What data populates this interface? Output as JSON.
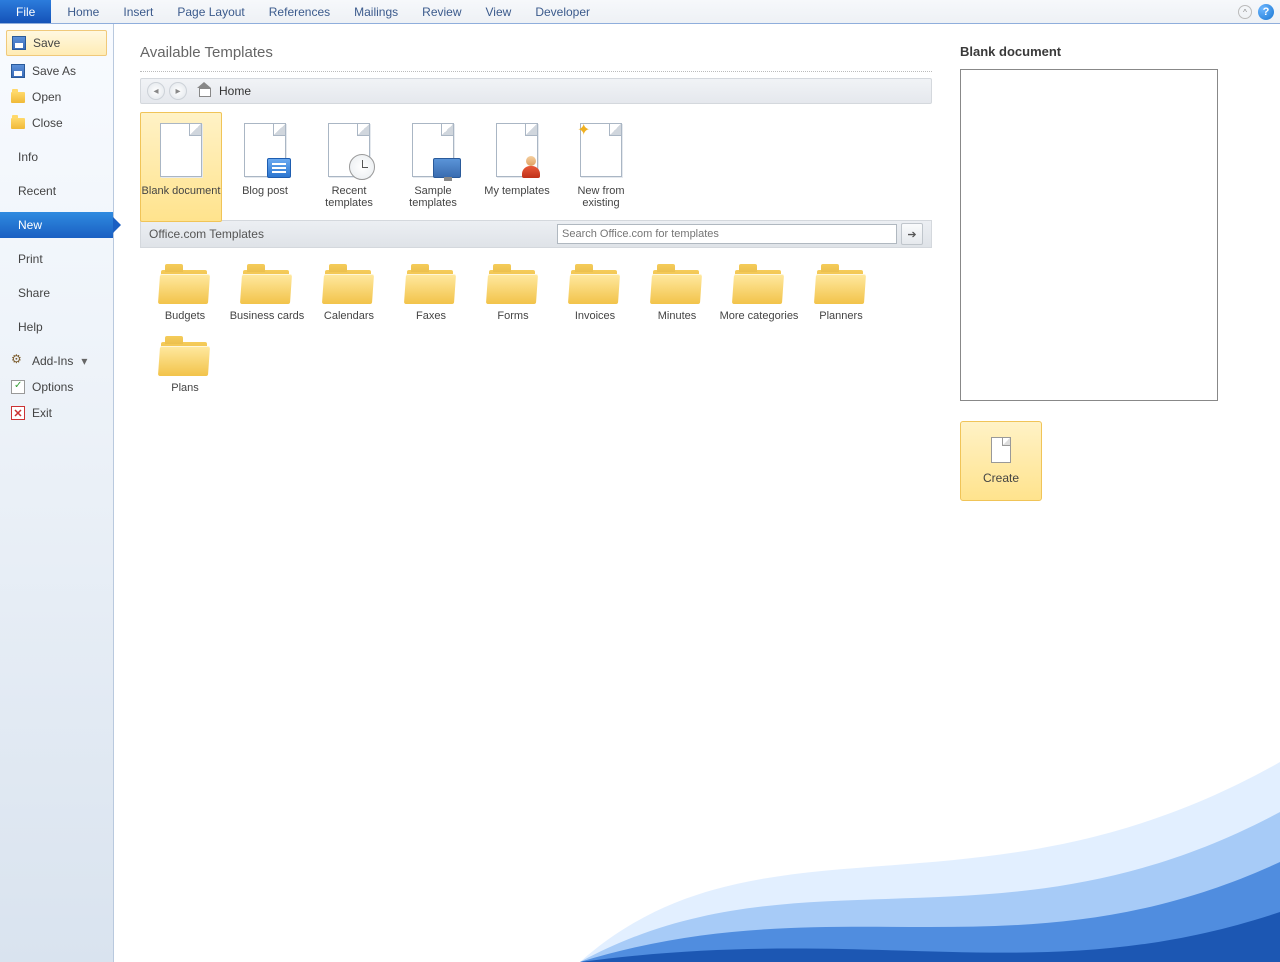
{
  "ribbon": {
    "tabs": [
      "File",
      "Home",
      "Insert",
      "Page Layout",
      "References",
      "Mailings",
      "Review",
      "View",
      "Developer"
    ]
  },
  "sidebar": {
    "save": "Save",
    "saveas": "Save As",
    "open": "Open",
    "close": "Close",
    "info": "Info",
    "recent": "Recent",
    "new": "New",
    "print": "Print",
    "share": "Share",
    "help": "Help",
    "addins": "Add-Ins",
    "options": "Options",
    "exit": "Exit"
  },
  "main": {
    "title": "Available Templates",
    "breadcrumb_home": "Home",
    "templates": {
      "blank": "Blank document",
      "blog": "Blog post",
      "recent": "Recent templates",
      "sample": "Sample templates",
      "my": "My templates",
      "newfrom": "New from existing"
    },
    "office_label": "Office.com Templates",
    "search_placeholder": "Search Office.com for templates",
    "categories": [
      "Budgets",
      "Business cards",
      "Calendars",
      "Faxes",
      "Forms",
      "Invoices",
      "Minutes",
      "More categories",
      "Planners",
      "Plans"
    ]
  },
  "right": {
    "title": "Blank document",
    "create": "Create"
  }
}
